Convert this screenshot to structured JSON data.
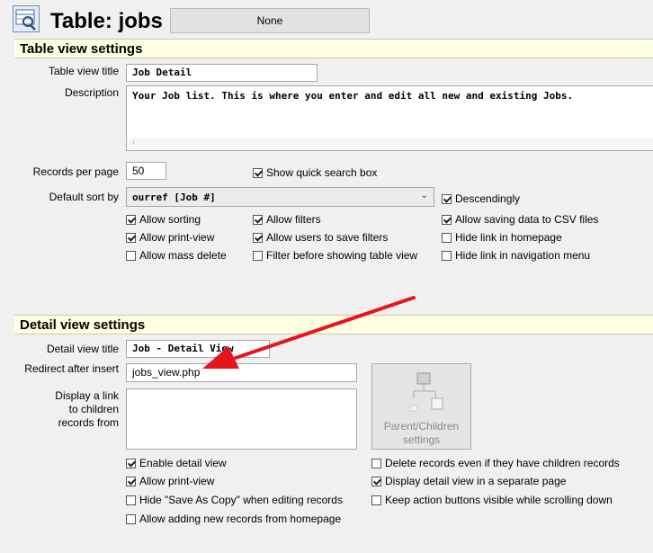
{
  "header": {
    "title": "Table: jobs",
    "badge": "None",
    "icon": "table-search-icon"
  },
  "table_view": {
    "section_title": "Table view settings",
    "title_label": "Table view title",
    "title_value": "Job Detail",
    "description_label": "Description",
    "description_value": "Your Job list.  This is where you enter and edit all new and existing Jobs.",
    "records_label": "Records per page",
    "records_value": "50",
    "quick_search_label": "Show quick search box",
    "sort_label": "Default sort by",
    "sort_value": "ourref [Job #]",
    "descending_label": "Descendingly",
    "options": {
      "allow_sorting": "Allow sorting",
      "allow_filters": "Allow filters",
      "allow_csv": "Allow saving data to CSV files",
      "allow_print": "Allow print-view",
      "allow_save_filters": "Allow users to save filters",
      "hide_home": "Hide link in homepage",
      "allow_mass_delete": "Allow mass delete",
      "filter_before": "Filter before showing table view",
      "hide_nav": "Hide link in navigation menu"
    }
  },
  "detail_view": {
    "section_title": "Detail view settings",
    "title_label": "Detail view title",
    "title_value": "Job - Detail View",
    "redirect_label": "Redirect after insert",
    "redirect_value": "jobs_view.php",
    "children_label_1": "Display a link",
    "children_label_2": "to children",
    "children_label_3": "records from",
    "pc_button_line1": "Parent/Children",
    "pc_button_line2": "settings",
    "options": {
      "enable_detail": "Enable detail view",
      "delete_children": "Delete records even if they have children records",
      "allow_print": "Allow print-view",
      "separate_page": "Display detail view in a separate page",
      "hide_save_copy": "Hide \"Save As Copy\" when editing records",
      "keep_buttons": "Keep action buttons visible while scrolling down",
      "allow_add_home": "Allow adding new records from homepage"
    }
  },
  "colors": {
    "section_bg": "#ffffe1",
    "arrow": "#e8141c"
  }
}
